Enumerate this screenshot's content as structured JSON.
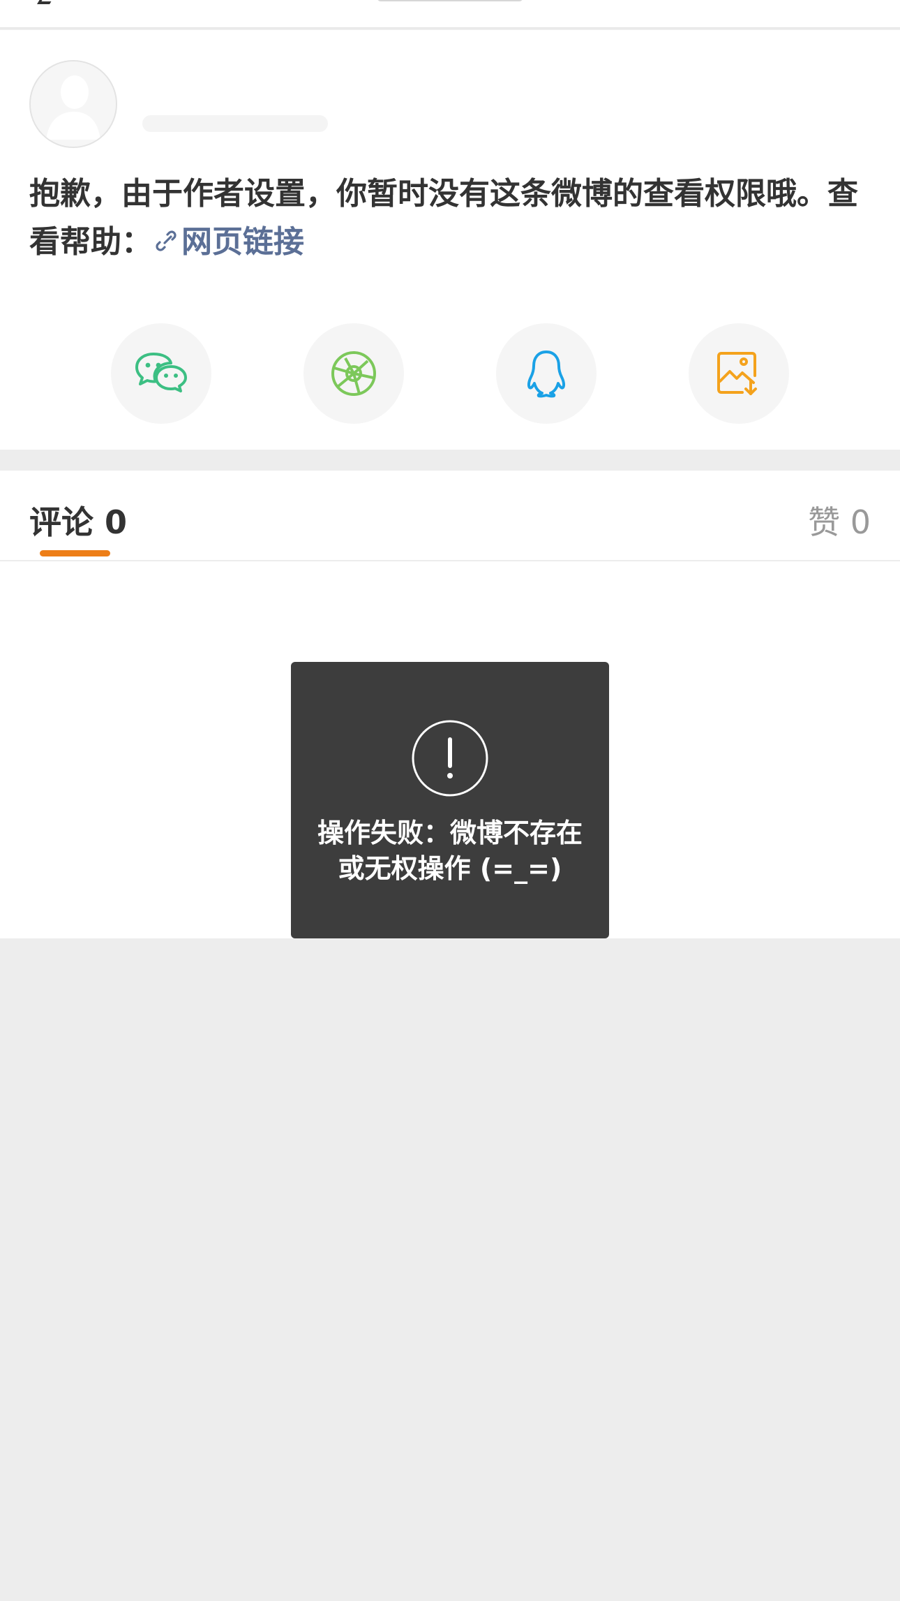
{
  "post": {
    "text": "抱歉，由于作者设置，你暂时没有这条微博的查看权限哦。查看帮助：",
    "link_label": "网页链接"
  },
  "share": [
    {
      "id": "wechat",
      "icon": "wechat-icon",
      "color": "#3cbf83"
    },
    {
      "id": "moments",
      "icon": "moments-aperture-icon",
      "color": "#7cc85a"
    },
    {
      "id": "qq",
      "icon": "qq-penguin-icon",
      "color": "#1aa1e6"
    },
    {
      "id": "save-image",
      "icon": "save-image-icon",
      "color": "#f4a21c"
    }
  ],
  "tabs": {
    "comments_label": "评论 0",
    "likes_label": "赞 0",
    "accent_color": "#ed7e17"
  },
  "toast": {
    "icon": "exclamation-circle-icon",
    "message": "操作失败：微博不存在或无权操作 (=_=)"
  }
}
